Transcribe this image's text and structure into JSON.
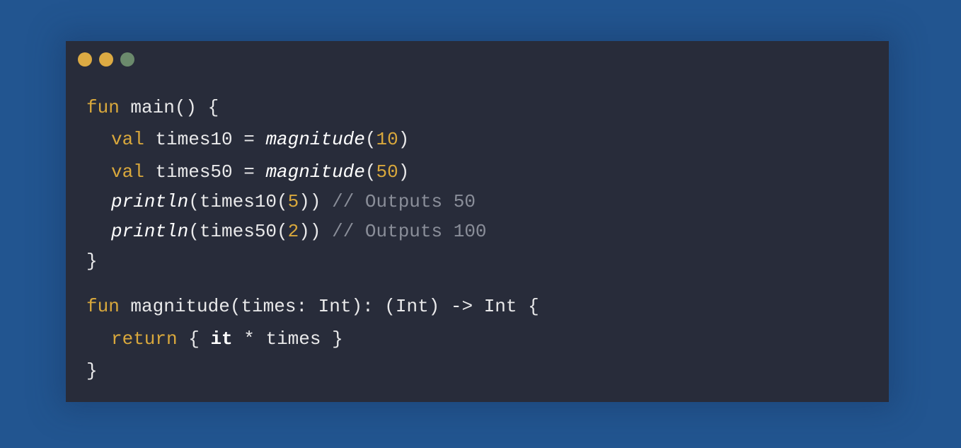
{
  "window": {
    "dots": [
      {
        "name": "yellow-dot",
        "color": "#dcaa43"
      },
      {
        "name": "yellow-dot-2",
        "color": "#dcaa43"
      },
      {
        "name": "green-dot",
        "color": "#6b8a6c"
      }
    ]
  },
  "code": {
    "line1": {
      "kw": "fun",
      "rest": " main() {"
    },
    "line2": {
      "indent": "",
      "kw": "val",
      "name": " times10 = ",
      "call": "magnitude",
      "open": "(",
      "num": "10",
      "close": ")"
    },
    "line3": {
      "indent": "",
      "kw": "val",
      "name": " times50 = ",
      "call": "magnitude",
      "open": "(",
      "num": "50",
      "close": ")"
    },
    "line4": {
      "call": "println",
      "open": "(times10(",
      "num": "5",
      "close": "))",
      "comment": " // Outputs 50"
    },
    "line5": {
      "call": "println",
      "open": "(times50(",
      "num": "2",
      "close": "))",
      "comment": " // Outputs 100"
    },
    "line6": {
      "text": "}"
    },
    "line7": {
      "kw": "fun",
      "rest": " magnitude(times: Int): (Int) -> Int {"
    },
    "line8": {
      "kw": "return",
      "pre": " { ",
      "it": "it",
      "post": " * times }"
    },
    "line9": {
      "text": "}"
    }
  },
  "colors": {
    "background": "#225590",
    "editor": "#282c3a",
    "keyword": "#d9a83c",
    "comment": "#8a8e99",
    "text": "#e9e9ea"
  }
}
